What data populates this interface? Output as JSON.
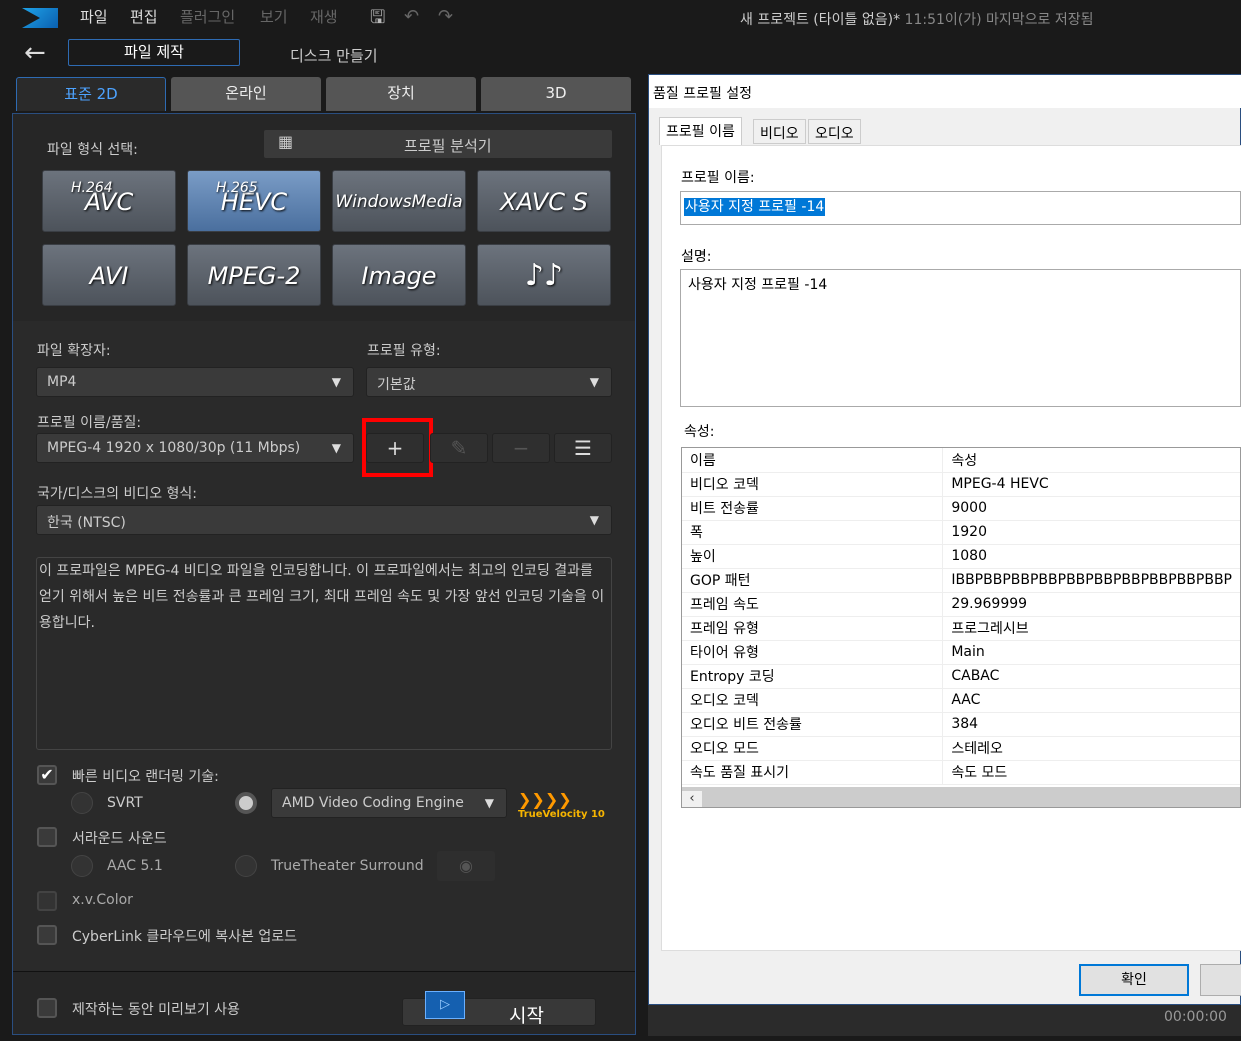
{
  "menu": {
    "file": "파일",
    "edit": "편집",
    "plugin": "플러그인",
    "view": "보기",
    "play": "재생"
  },
  "project_status": {
    "title": "새 프로젝트 (타이틀 없음)*",
    "saved": "11:51이(가) 마지막으로 저장됨"
  },
  "nav": {
    "produce_file": "파일 제작",
    "create_disc": "디스크 만들기"
  },
  "tabs": [
    "표준 2D",
    "온라인",
    "장치",
    "3D"
  ],
  "format": {
    "label": "파일 형식 선택:",
    "analyzer": "프로필 분석기",
    "buttons": [
      {
        "sup": "H.264",
        "label": "AVC"
      },
      {
        "sup": "H.265",
        "label": "HEVC"
      },
      {
        "sup": "",
        "label": "WindowsMedia"
      },
      {
        "sup": "",
        "label": "XAVC S"
      },
      {
        "sup": "",
        "label": "AVI"
      },
      {
        "sup": "",
        "label": "MPEG-2"
      },
      {
        "sup": "",
        "label": "Image"
      },
      {
        "sup": "",
        "label": "♪♪"
      }
    ]
  },
  "ext": {
    "label": "파일 확장자:",
    "value": "MP4"
  },
  "ptype": {
    "label": "프로필 유형:",
    "value": "기본값"
  },
  "pname": {
    "label": "프로필 이름/품질:",
    "value": "MPEG-4 1920 x 1080/30p (11 Mbps)"
  },
  "region": {
    "label": "국가/디스크의 비디오 형식:",
    "value": "한국 (NTSC)"
  },
  "description": "이 프로파일은 MPEG-4 비디오 파일을 인코딩합니다. 이 프로파일에서는 최고의 인코딩 결과를 얻기 위해서 높은 비트 전송률과 큰 프레임 크기, 최대 프레임 속도 및 가장 앞선 인코딩 기술을 이용합니다.",
  "options": {
    "fast_render": "빠른 비디오 랜더링 기술:",
    "svrt": "SVRT",
    "engine": "AMD Video Coding Engine",
    "surround": "서라운드 사운드",
    "aac": "AAC 5.1",
    "truetheater": "TrueTheater Surround",
    "xvcolor": "x.v.Color",
    "cloud": "CyberLink 클라우드에 복사본 업로드",
    "preview": "제작하는 동안 미리보기 사용",
    "start": "시작",
    "tv_logo": "TrueVelocity 10"
  },
  "dialog": {
    "title": "품질 프로필 설정",
    "tabs": [
      "프로필 이름",
      "비디오",
      "오디오"
    ],
    "name_label": "프로필 이름:",
    "name_value": "사용자 지정 프로필 -14",
    "desc_label": "설명:",
    "desc_value": "사용자 지정 프로필 -14",
    "attr_label": "속성:",
    "headers": [
      "이름",
      "속성"
    ],
    "rows": [
      [
        "비디오 코덱",
        "MPEG-4 HEVC"
      ],
      [
        "비트 전송률",
        "9000"
      ],
      [
        "폭",
        "1920"
      ],
      [
        "높이",
        "1080"
      ],
      [
        "GOP 패턴",
        "IBBPBBPBBPBBPBBPBBPBBPBBPBBPBBP"
      ],
      [
        "프레임 속도",
        "29.969999"
      ],
      [
        "프레임 유형",
        "프로그레시브"
      ],
      [
        "타이어 유형",
        "Main"
      ],
      [
        "Entropy 코딩",
        "CABAC"
      ],
      [
        "오디오 코덱",
        "AAC"
      ],
      [
        "오디오 비트 전송률",
        "384"
      ],
      [
        "오디오 모드",
        "스테레오"
      ],
      [
        "속도 품질 표시기",
        "속도 모드"
      ]
    ],
    "ok": "확인"
  },
  "timecode": "00:00:00"
}
